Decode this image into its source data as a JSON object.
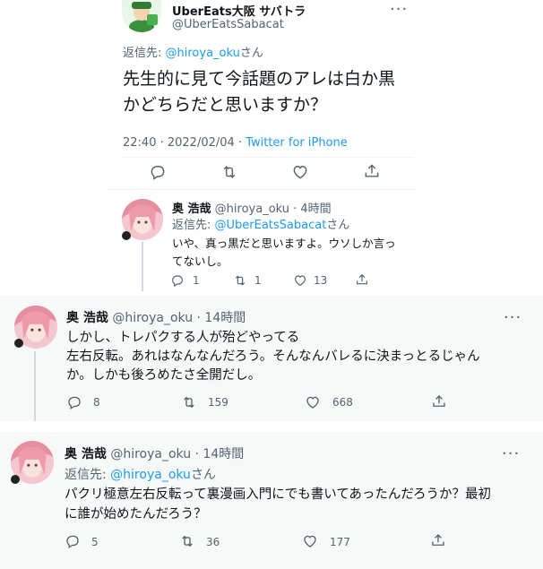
{
  "main_tweet": {
    "display_name": "UberEats大阪 サバトラ",
    "handle": "@UberEatsSabacat",
    "reply_prefix": "返信先: ",
    "reply_to": "@hiroya_oku",
    "reply_suffix": "さん",
    "text_line1": "先生的に見て今話題のアレは白か黒",
    "text_line2": "かどちらだと思いますか？",
    "timestamp": "22:40 · 2022/02/04 · ",
    "source": "Twitter for iPhone"
  },
  "reply1": {
    "display_name": "奥 浩哉",
    "meta": "@hiroya_oku · 4時間",
    "reply_prefix": "返信先: ",
    "reply_to": "@UberEatsSabacat",
    "reply_suffix": "さん",
    "text_line1": "いや、真っ黒だと思いますよ。ウソしか言っ",
    "text_line2": "てないし。",
    "replies": "1",
    "retweets": "1",
    "likes": "13"
  },
  "reply2": {
    "display_name": "奥 浩哉",
    "meta": "@hiroya_oku · 14時間",
    "text_line1": "しかし、トレパクする人が殆どやってる",
    "text_line2": "左右反転。あれはなんなんだろう。そんなんバレるに決まっとるじゃん",
    "text_line3": "か。しかも後ろめたさ全開だし。",
    "replies": "8",
    "retweets": "159",
    "likes": "668"
  },
  "reply3": {
    "display_name": "奥 浩哉",
    "meta": "@hiroya_oku · 14時間",
    "reply_prefix": "返信先: ",
    "reply_to": "@hiroya_oku",
    "reply_suffix": "さん",
    "text_line1": "パクリ極意左右反転って裏漫画入門にでも書いてあったんだろうか？最初",
    "text_line2": "に誰が始めたんだろう？",
    "replies": "5",
    "retweets": "36",
    "likes": "177"
  },
  "more_glyph": "···",
  "colors": {
    "link": "#1d9bf0",
    "muted": "#536471",
    "card_bg": "#f7f9f9",
    "border": "#cfd9de"
  }
}
